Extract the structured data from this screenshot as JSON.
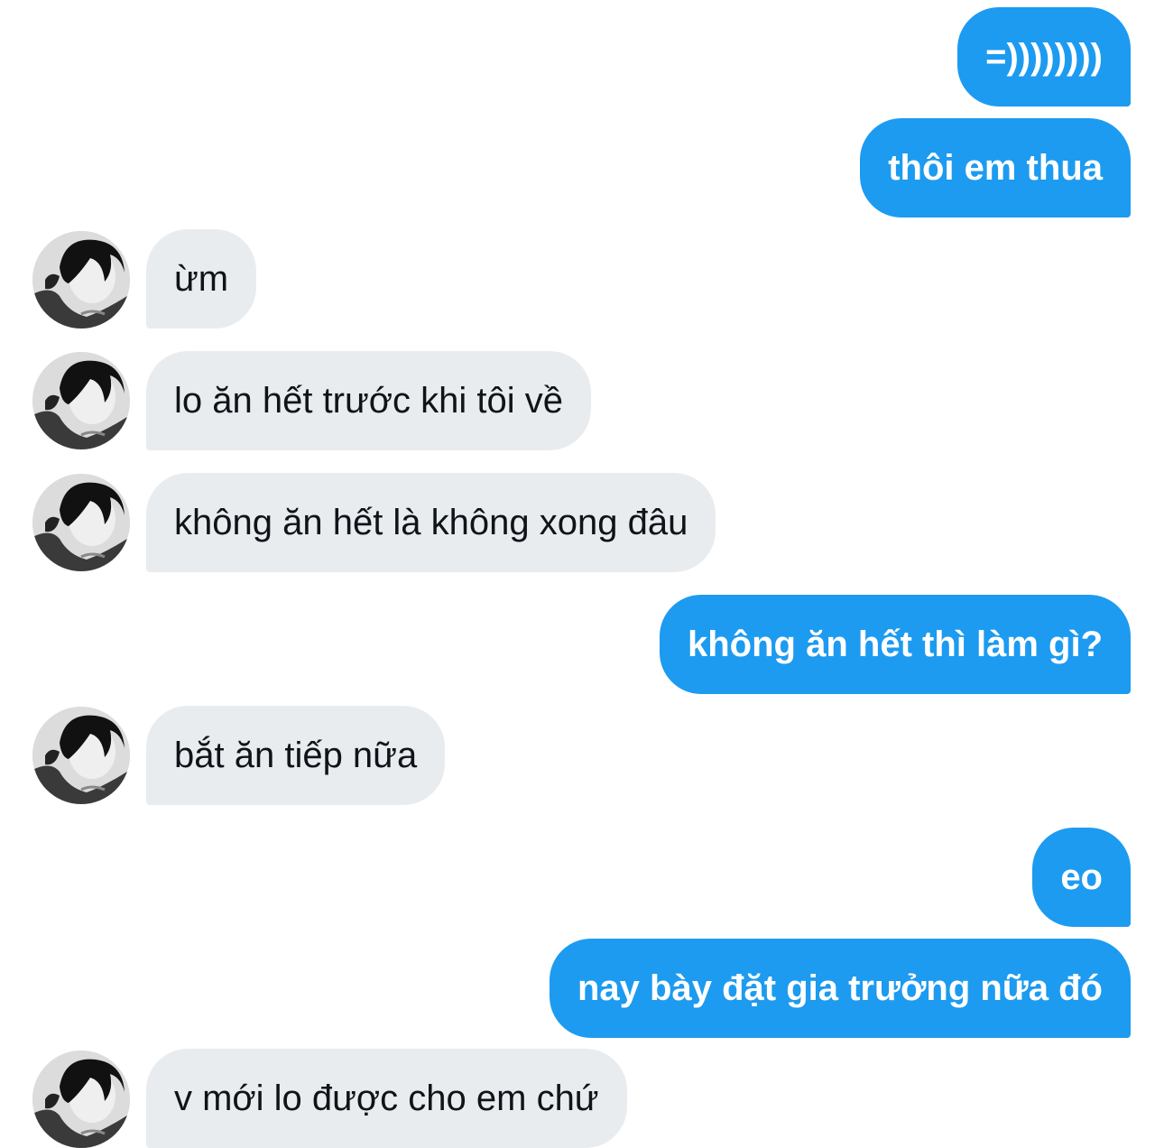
{
  "messages": [
    {
      "side": "sent",
      "text": "=))))))))"
    },
    {
      "side": "sent",
      "text": "thôi em thua"
    },
    {
      "side": "received",
      "text": "ừm",
      "avatar": "user-avatar-photo"
    },
    {
      "side": "received",
      "text": "lo ăn hết trước khi tôi về",
      "avatar": "user-avatar-photo"
    },
    {
      "side": "received",
      "text": "không ăn hết là không xong đâu",
      "avatar": "user-avatar-photo"
    },
    {
      "side": "sent",
      "text": "không ăn hết thì làm gì?"
    },
    {
      "side": "received",
      "text": "bắt ăn tiếp nữa",
      "avatar": "user-avatar-photo"
    },
    {
      "side": "sent",
      "text": "eo"
    },
    {
      "side": "sent",
      "text": "nay bày đặt gia trưởng nữa đó"
    },
    {
      "side": "received",
      "text": "v mới lo được cho em chứ",
      "avatar": "user-avatar-photo"
    }
  ],
  "colors": {
    "sent_bubble": "#1d9bf0",
    "sent_text": "#ffffff",
    "received_bubble": "#e9ecef",
    "received_text": "#0f1419"
  }
}
